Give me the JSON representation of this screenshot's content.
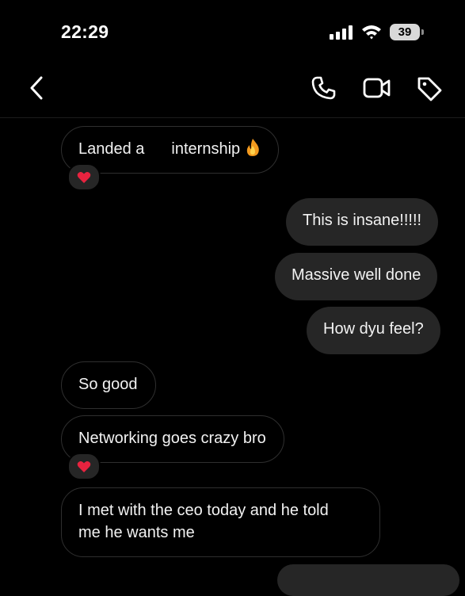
{
  "status_bar": {
    "time": "22:29",
    "battery_level": "39"
  },
  "header": {
    "icons": {
      "back": "chevron-left-icon",
      "call": "phone-icon",
      "video": "video-camera-icon",
      "info": "tag-icon"
    }
  },
  "messages": [
    {
      "direction": "incoming",
      "text_a": "Landed a",
      "text_b": "internship",
      "emoji": "fire-emoji",
      "reaction": "heart"
    },
    {
      "direction": "outgoing",
      "text": "This is insane!!!!!"
    },
    {
      "direction": "outgoing",
      "text": "Massive well done"
    },
    {
      "direction": "outgoing",
      "text": "How dyu feel?"
    },
    {
      "direction": "incoming",
      "text": "So good"
    },
    {
      "direction": "incoming",
      "text": "Networking goes crazy bro",
      "reaction": "heart"
    },
    {
      "direction": "incoming",
      "line_1": "I met with the ceo today and he told",
      "line_2": "me he wants me"
    }
  ],
  "colors": {
    "background": "#000000",
    "outgoing_bubble": "#262626",
    "incoming_border": "#2f2f2f",
    "heart": "#e8233f"
  }
}
